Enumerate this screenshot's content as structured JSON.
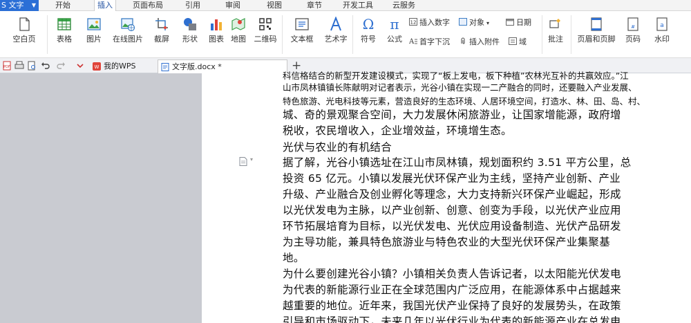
{
  "menubar": {
    "app_label": "S 文字",
    "tabs": [
      "开始",
      "插入",
      "页面布局",
      "引用",
      "审阅",
      "视图",
      "章节",
      "开发工具",
      "云服务"
    ],
    "active_tab": "插入"
  },
  "ribbon": {
    "blank_page": "空白页",
    "table": "表格",
    "picture": "图片",
    "online_picture": "在线图片",
    "screenshot": "截屏",
    "shape": "形状",
    "chart": "图表",
    "map": "地图",
    "qrcode": "二维码",
    "textbox": "文本框",
    "wordart": "艺术字",
    "symbol": "符号",
    "formula": "公式",
    "insert_number": "插入数字",
    "object": "对象",
    "date": "日期",
    "drop_cap": "首字下沉",
    "insert_attachment": "插入附件",
    "field": "域",
    "comment": "批注",
    "header_footer": "页眉和页脚",
    "page_number": "页码",
    "watermark": "水印"
  },
  "tabs_bar": {
    "my_wps": "我的WPS",
    "doc_tab": "文字版.docx *"
  },
  "document": {
    "lines_small": [
      "科信格结合的新型开发建设模式，实现了“板上发电，板下种植”农林光互补的共赢效应。”江",
      "山市凤林镇镇长陈献明对记者表示，光谷小镇在实现一二产融合的同时，还要融入产业发展、",
      "特色旅游、光电科技等元素，营造良好的生态环境、人居环境空间，打造水、林、田、岛、村、"
    ],
    "lines_large": [
      "城、奇的景观聚合空间，大力发展休闲旅游业，让国家增能源，政府增",
      "税收，农民增收入，企业增效益，环境增生态。",
      "光伏与农业的有机结合",
      "据了解，光谷小镇选址在江山市凤林镇，规划面积约 3.51 平方公里，总",
      "投资 65 亿元。小镇以发展光伏环保产业为主线，坚持产业创新、产业",
      "升级、产业融合及创业孵化等理念，大力支持新兴环保产业崛起，形成",
      "以光伏发电为主脉，以产业创新、创意、创变为手段，以光伏产业应用",
      "环节拓展培育为目标，以光伏发电、光伏应用设备制造、光伏产品研发",
      "为主导功能，兼具特色旅游业与特色农业的大型光伏环保产业集聚基",
      "地。",
      "为什么要创建光谷小镇？小镇相关负责人告诉记者，以太阳能光伏发电",
      "为代表的新能源行业正在全球范围内广泛应用，在能源体系中占据越来",
      "越重要的地位。近年来，我国光伏产业保持了良好的发展势头，在政策",
      "引导和市场驱动下，未来几年以光伏行业为代表的新能源产业在总发电"
    ]
  },
  "colors": {
    "accent": "#2b6fd6",
    "ribbon_bg": "#ffffff",
    "canvas_bg": "#c9cbd1"
  }
}
